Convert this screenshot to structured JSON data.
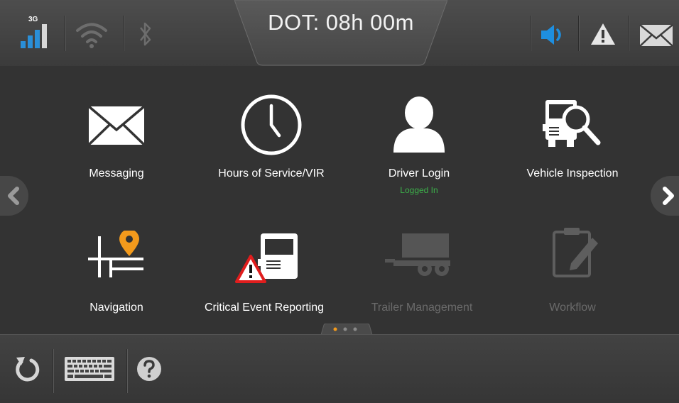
{
  "status_bar": {
    "network_type": "3G",
    "dot_clock": "DOT: 08h 00m"
  },
  "tiles": [
    {
      "label": "Messaging",
      "enabled": true
    },
    {
      "label": "Hours of Service/VIR",
      "enabled": true
    },
    {
      "label": "Driver Login",
      "status": "Logged In",
      "enabled": true
    },
    {
      "label": "Vehicle Inspection",
      "enabled": true
    },
    {
      "label": "Navigation",
      "enabled": true
    },
    {
      "label": "Critical Event Reporting",
      "enabled": true
    },
    {
      "label": "Trailer Management",
      "enabled": false
    },
    {
      "label": "Workflow",
      "enabled": false
    }
  ],
  "pager": {
    "page_count": 3,
    "current_page": 1
  },
  "colors": {
    "accent_blue": "#1e8fe0",
    "signal_blue": "#2a8fd8",
    "status_green": "#3cb04a",
    "pin_orange": "#f39a1c",
    "warning_red": "#e01d1d",
    "page_dot_active": "#f39a1c"
  },
  "icons": {
    "signal": "signal-bars-icon",
    "wifi": "wifi-icon",
    "bluetooth": "bluetooth-icon",
    "speaker": "speaker-icon",
    "alert": "warning-icon",
    "mail": "envelope-icon",
    "refresh": "refresh-icon",
    "keyboard": "keyboard-icon",
    "help": "help-icon"
  }
}
